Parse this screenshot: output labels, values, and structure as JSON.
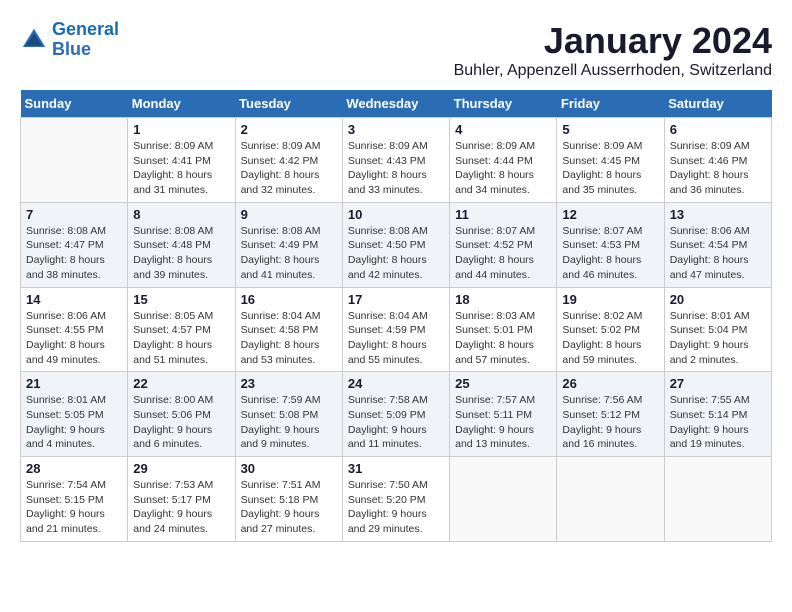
{
  "logo": {
    "line1": "General",
    "line2": "Blue"
  },
  "title": "January 2024",
  "location": "Buhler, Appenzell Ausserrhoden, Switzerland",
  "weekdays": [
    "Sunday",
    "Monday",
    "Tuesday",
    "Wednesday",
    "Thursday",
    "Friday",
    "Saturday"
  ],
  "weeks": [
    [
      {
        "day": "",
        "info": ""
      },
      {
        "day": "1",
        "info": "Sunrise: 8:09 AM\nSunset: 4:41 PM\nDaylight: 8 hours\nand 31 minutes."
      },
      {
        "day": "2",
        "info": "Sunrise: 8:09 AM\nSunset: 4:42 PM\nDaylight: 8 hours\nand 32 minutes."
      },
      {
        "day": "3",
        "info": "Sunrise: 8:09 AM\nSunset: 4:43 PM\nDaylight: 8 hours\nand 33 minutes."
      },
      {
        "day": "4",
        "info": "Sunrise: 8:09 AM\nSunset: 4:44 PM\nDaylight: 8 hours\nand 34 minutes."
      },
      {
        "day": "5",
        "info": "Sunrise: 8:09 AM\nSunset: 4:45 PM\nDaylight: 8 hours\nand 35 minutes."
      },
      {
        "day": "6",
        "info": "Sunrise: 8:09 AM\nSunset: 4:46 PM\nDaylight: 8 hours\nand 36 minutes."
      }
    ],
    [
      {
        "day": "7",
        "info": "Sunrise: 8:08 AM\nSunset: 4:47 PM\nDaylight: 8 hours\nand 38 minutes."
      },
      {
        "day": "8",
        "info": "Sunrise: 8:08 AM\nSunset: 4:48 PM\nDaylight: 8 hours\nand 39 minutes."
      },
      {
        "day": "9",
        "info": "Sunrise: 8:08 AM\nSunset: 4:49 PM\nDaylight: 8 hours\nand 41 minutes."
      },
      {
        "day": "10",
        "info": "Sunrise: 8:08 AM\nSunset: 4:50 PM\nDaylight: 8 hours\nand 42 minutes."
      },
      {
        "day": "11",
        "info": "Sunrise: 8:07 AM\nSunset: 4:52 PM\nDaylight: 8 hours\nand 44 minutes."
      },
      {
        "day": "12",
        "info": "Sunrise: 8:07 AM\nSunset: 4:53 PM\nDaylight: 8 hours\nand 46 minutes."
      },
      {
        "day": "13",
        "info": "Sunrise: 8:06 AM\nSunset: 4:54 PM\nDaylight: 8 hours\nand 47 minutes."
      }
    ],
    [
      {
        "day": "14",
        "info": "Sunrise: 8:06 AM\nSunset: 4:55 PM\nDaylight: 8 hours\nand 49 minutes."
      },
      {
        "day": "15",
        "info": "Sunrise: 8:05 AM\nSunset: 4:57 PM\nDaylight: 8 hours\nand 51 minutes."
      },
      {
        "day": "16",
        "info": "Sunrise: 8:04 AM\nSunset: 4:58 PM\nDaylight: 8 hours\nand 53 minutes."
      },
      {
        "day": "17",
        "info": "Sunrise: 8:04 AM\nSunset: 4:59 PM\nDaylight: 8 hours\nand 55 minutes."
      },
      {
        "day": "18",
        "info": "Sunrise: 8:03 AM\nSunset: 5:01 PM\nDaylight: 8 hours\nand 57 minutes."
      },
      {
        "day": "19",
        "info": "Sunrise: 8:02 AM\nSunset: 5:02 PM\nDaylight: 8 hours\nand 59 minutes."
      },
      {
        "day": "20",
        "info": "Sunrise: 8:01 AM\nSunset: 5:04 PM\nDaylight: 9 hours\nand 2 minutes."
      }
    ],
    [
      {
        "day": "21",
        "info": "Sunrise: 8:01 AM\nSunset: 5:05 PM\nDaylight: 9 hours\nand 4 minutes."
      },
      {
        "day": "22",
        "info": "Sunrise: 8:00 AM\nSunset: 5:06 PM\nDaylight: 9 hours\nand 6 minutes."
      },
      {
        "day": "23",
        "info": "Sunrise: 7:59 AM\nSunset: 5:08 PM\nDaylight: 9 hours\nand 9 minutes."
      },
      {
        "day": "24",
        "info": "Sunrise: 7:58 AM\nSunset: 5:09 PM\nDaylight: 9 hours\nand 11 minutes."
      },
      {
        "day": "25",
        "info": "Sunrise: 7:57 AM\nSunset: 5:11 PM\nDaylight: 9 hours\nand 13 minutes."
      },
      {
        "day": "26",
        "info": "Sunrise: 7:56 AM\nSunset: 5:12 PM\nDaylight: 9 hours\nand 16 minutes."
      },
      {
        "day": "27",
        "info": "Sunrise: 7:55 AM\nSunset: 5:14 PM\nDaylight: 9 hours\nand 19 minutes."
      }
    ],
    [
      {
        "day": "28",
        "info": "Sunrise: 7:54 AM\nSunset: 5:15 PM\nDaylight: 9 hours\nand 21 minutes."
      },
      {
        "day": "29",
        "info": "Sunrise: 7:53 AM\nSunset: 5:17 PM\nDaylight: 9 hours\nand 24 minutes."
      },
      {
        "day": "30",
        "info": "Sunrise: 7:51 AM\nSunset: 5:18 PM\nDaylight: 9 hours\nand 27 minutes."
      },
      {
        "day": "31",
        "info": "Sunrise: 7:50 AM\nSunset: 5:20 PM\nDaylight: 9 hours\nand 29 minutes."
      },
      {
        "day": "",
        "info": ""
      },
      {
        "day": "",
        "info": ""
      },
      {
        "day": "",
        "info": ""
      }
    ]
  ]
}
